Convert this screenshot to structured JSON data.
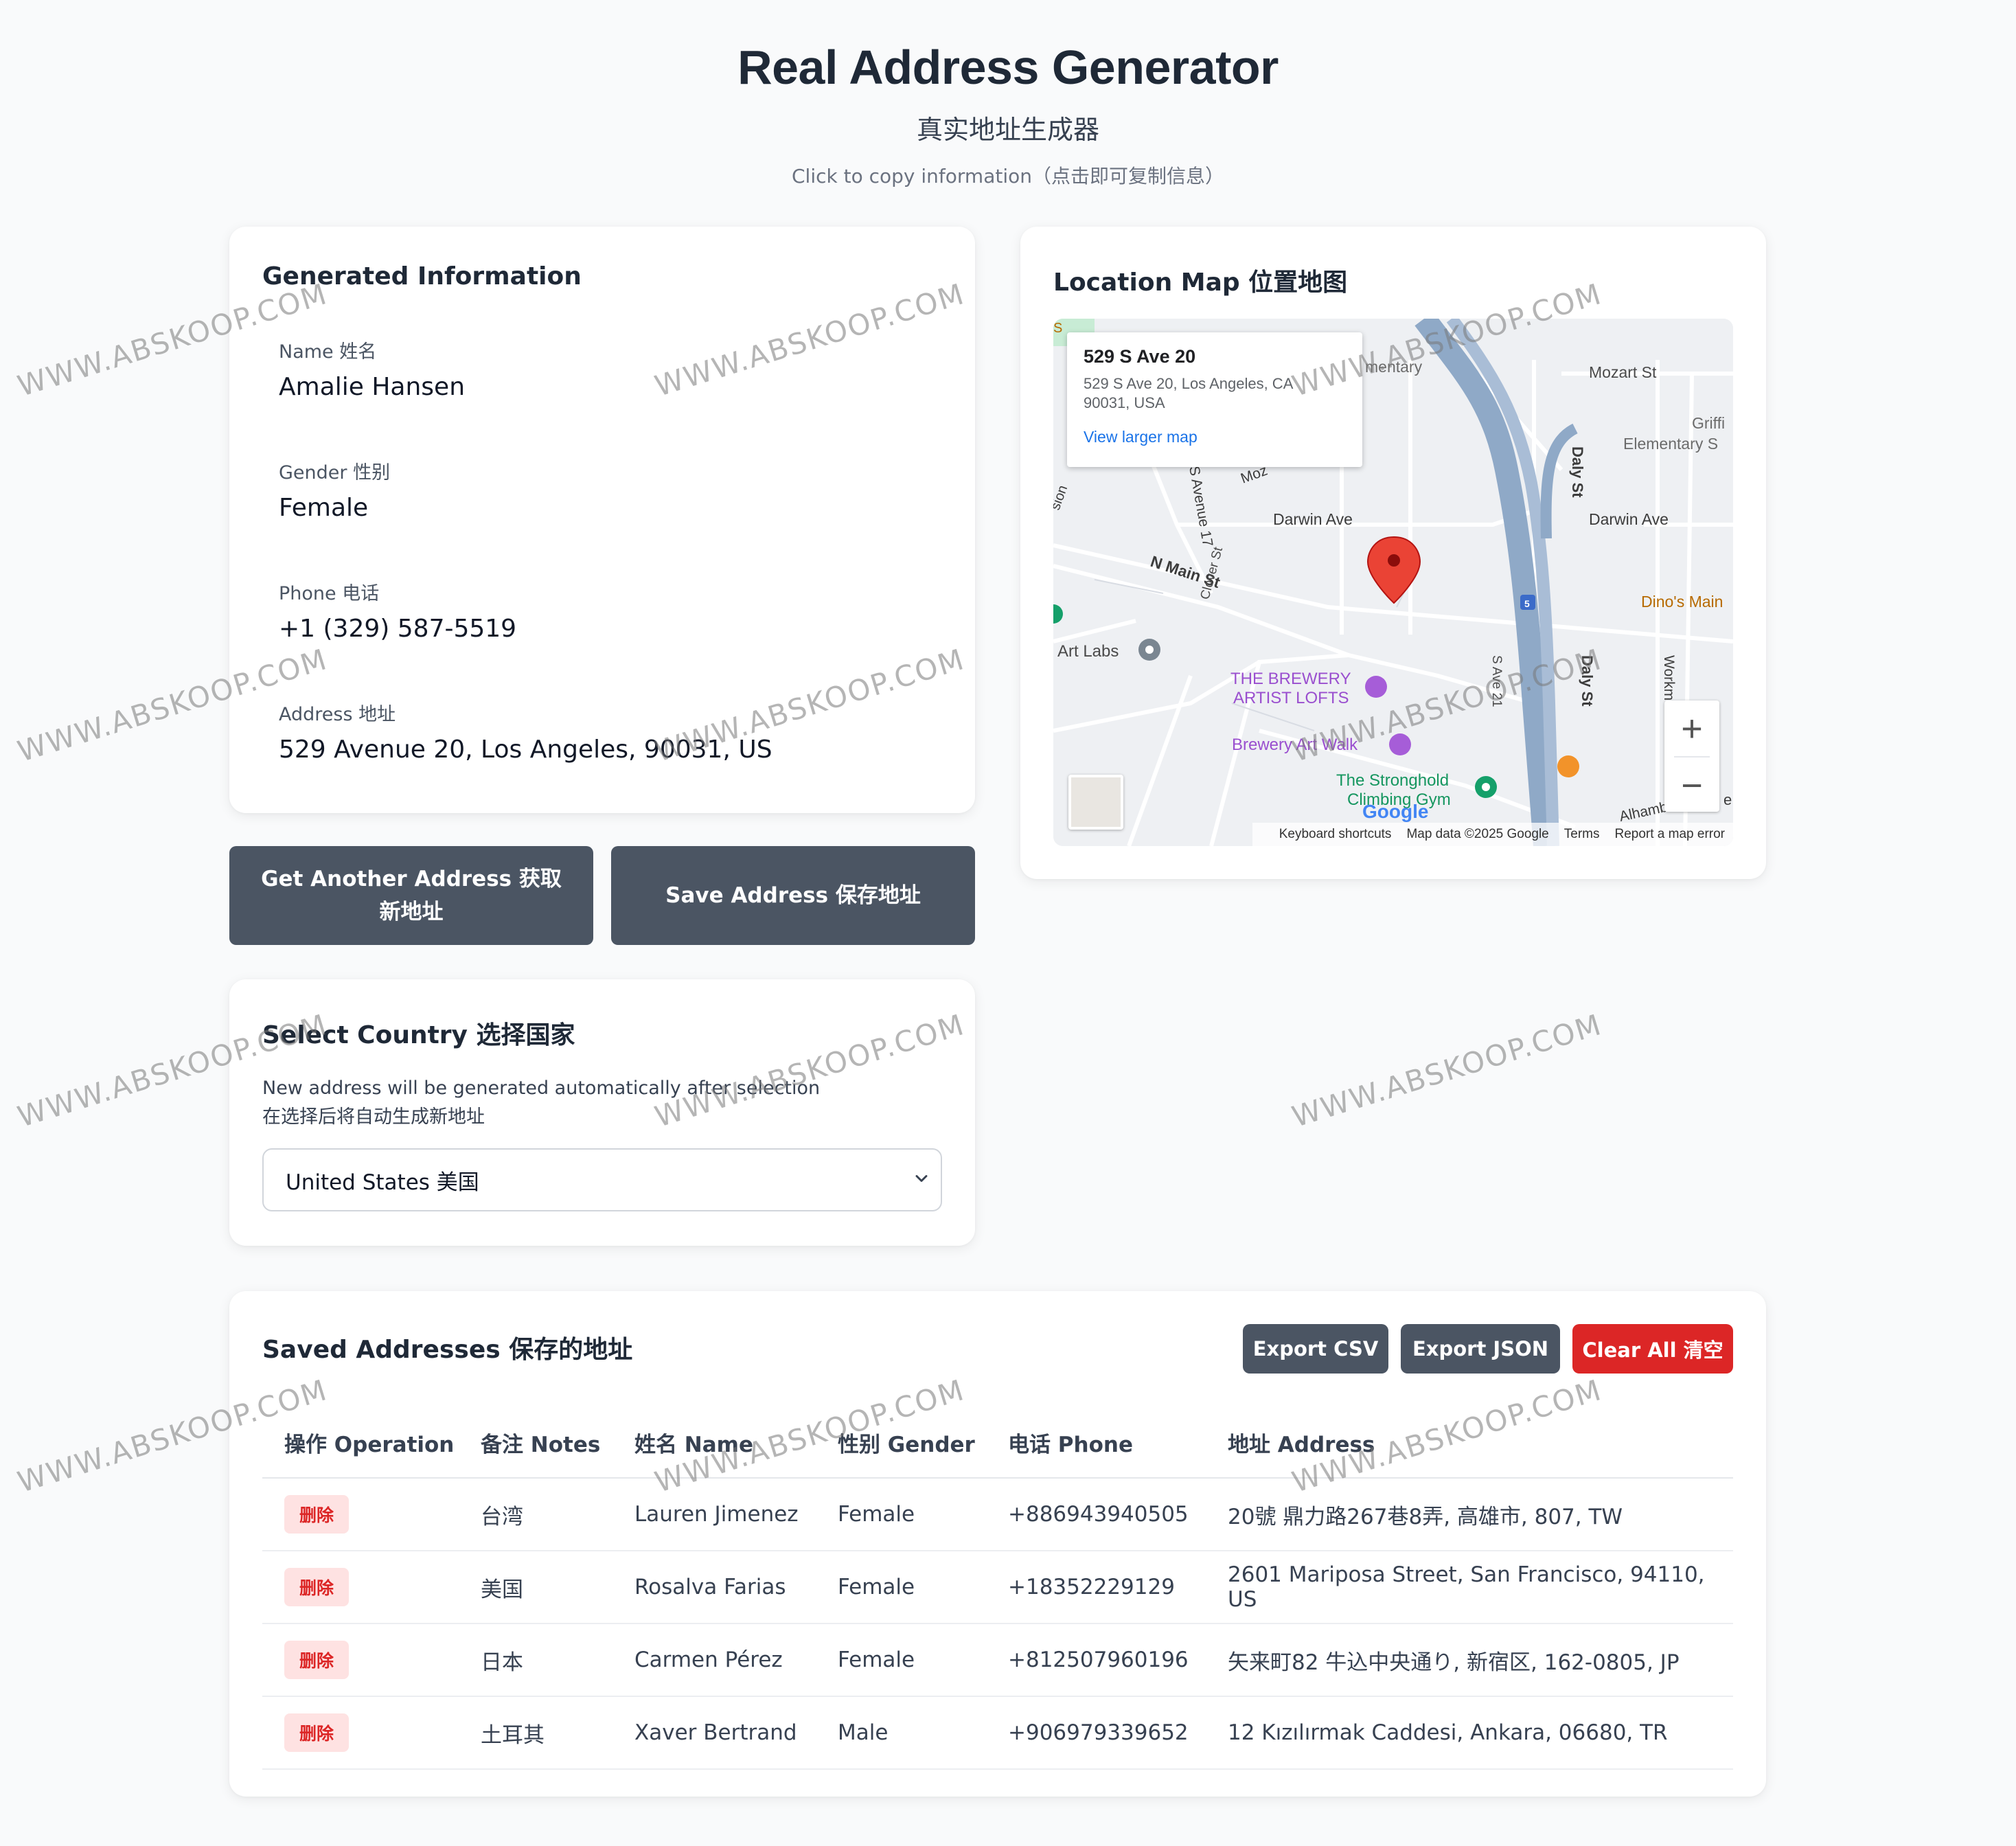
{
  "header": {
    "title": "Real Address Generator",
    "subtitle": "真实地址生成器",
    "hint": "Click to copy information（点击即可复制信息）"
  },
  "info": {
    "title": "Generated Information",
    "name_label": "Name 姓名",
    "name": "Amalie Hansen",
    "gender_label": "Gender 性别",
    "gender": "Female",
    "phone_label": "Phone 电话",
    "phone": "+1 (329) 587-5519",
    "address_label": "Address 地址",
    "address": "529 Avenue 20, Los Angeles, 90031, US"
  },
  "actions": {
    "another_label": "Get Another Address 获取新地址",
    "save_label": "Save Address 保存地址"
  },
  "country": {
    "title": "Select Country 选择国家",
    "desc_en": "New address will be generated automatically after selection",
    "desc_zh": "在选择后将自动生成新地址",
    "selected": "United States 美国"
  },
  "map": {
    "title": "Location Map 位置地图",
    "popup_title": "529 S Ave 20",
    "popup_address_line1": "529 S Ave 20, Los Angeles, CA",
    "popup_address_line2": "90031, USA",
    "popup_link": "View larger map",
    "labels": {
      "mozart": "Mozart St",
      "griffin1": "Griffi",
      "griffin2": "Elementary S",
      "darwin1": "Darwin Ave",
      "darwin2": "Darwin Ave",
      "nmain": "N Main St",
      "dinos": "Dino's Main",
      "artlabs": "Art Labs",
      "brewery1": "THE BREWERY",
      "brewery2": "ARTIST LOFTS",
      "brewerywalk": "Brewery Art Walk",
      "stronghold1": "The Stronghold",
      "stronghold2": "Climbing Gym",
      "elementary": "mentary",
      "dalyst": "Daly St",
      "ave17": "S Avenue 17",
      "mozart_short": "Moz",
      "clover": "Clover St",
      "ave21": "S Ave 21",
      "workman": "Workman St",
      "alhambra": "Alhamb",
      "route5": "5",
      "s_edge": "S",
      "e_edge": "e",
      "mission": "sion",
      "google": "Google"
    },
    "footer": {
      "shortcuts": "Keyboard shortcuts",
      "data": "Map data ©2025 Google",
      "terms": "Terms",
      "report": "Report a map error"
    },
    "zoom_in": "+",
    "zoom_out": "−"
  },
  "saved": {
    "title": "Saved Addresses 保存的地址",
    "export_csv": "Export CSV",
    "export_json": "Export JSON",
    "clear_all": "Clear All 清空",
    "headers": [
      "操作 Operation",
      "备注 Notes",
      "姓名 Name",
      "性别 Gender",
      "电话 Phone",
      "地址 Address"
    ],
    "delete_label": "删除",
    "rows": [
      {
        "notes": "台湾",
        "name": "Lauren Jimenez",
        "gender": "Female",
        "phone": "+886943940505",
        "address": "20號 鼎力路267巷8弄, 高雄市, 807, TW"
      },
      {
        "notes": "美国",
        "name": "Rosalva Farias",
        "gender": "Female",
        "phone": "+18352229129",
        "address": "2601 Mariposa Street, San Francisco, 94110, US"
      },
      {
        "notes": "日本",
        "name": "Carmen Pérez",
        "gender": "Female",
        "phone": "+812507960196",
        "address": "矢来町82 牛込中央通り, 新宿区, 162-0805, JP"
      },
      {
        "notes": "土耳其",
        "name": "Xaver Bertrand",
        "gender": "Male",
        "phone": "+906979339652",
        "address": "12 Kızılırmak Caddesi, Ankara, 06680, TR"
      }
    ]
  },
  "watermark": "WWW.ABSKOOP.COM",
  "colors": {
    "dark_button": "#4b5563",
    "danger": "#dc2626",
    "danger_soft": "#fee2e2",
    "link": "#1a73e8"
  }
}
